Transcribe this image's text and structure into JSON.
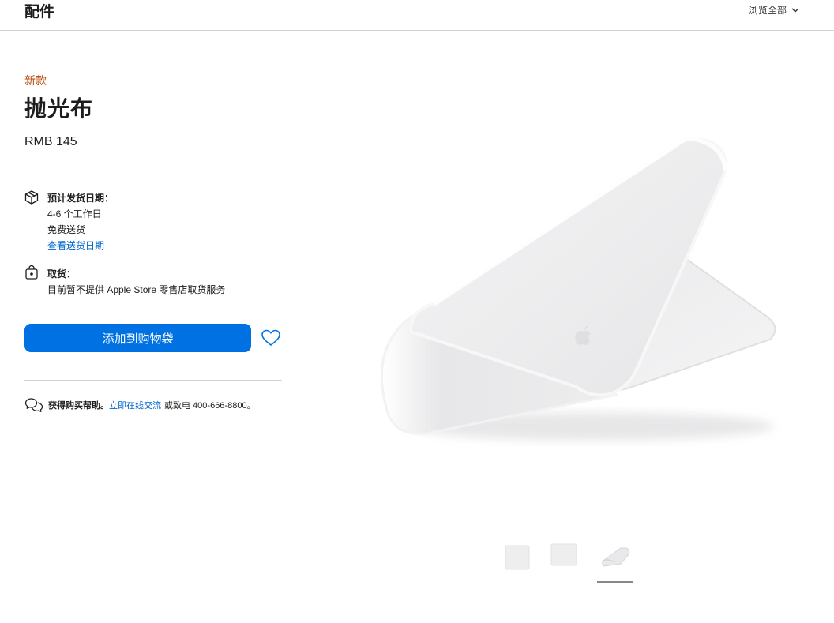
{
  "header": {
    "title": "配件",
    "browse_all_label": "浏览全部"
  },
  "product": {
    "badge": "新款",
    "name": "抛光布",
    "price": "RMB 145"
  },
  "delivery": {
    "heading": "预计发货日期：",
    "eta": "4-6 个工作日",
    "shipping": "免费送货",
    "check_link": "查看送货日期"
  },
  "pickup": {
    "heading": "取货：",
    "note": "目前暂不提供 Apple Store 零售店取货服务"
  },
  "actions": {
    "add_to_bag": "添加到购物袋"
  },
  "help": {
    "lead": "获得购买帮助。",
    "chat_link": "立即在线交流",
    "or_call": "或致电 400-666-8800。"
  },
  "colors": {
    "accent": "#0071e3",
    "link": "#0066cc",
    "badge": "#b64400"
  },
  "gallery": {
    "thumbnail_count": 3,
    "selected_index": 2
  }
}
